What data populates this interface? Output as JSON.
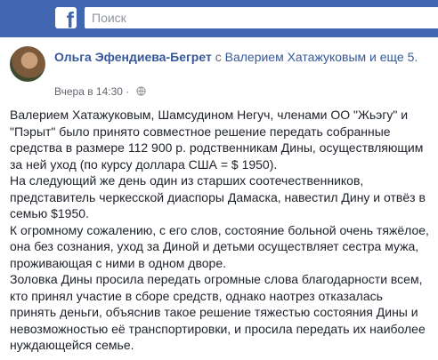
{
  "header": {
    "search_placeholder": "Поиск"
  },
  "post": {
    "author": "Ольга Эфендиева-Бегрет",
    "with_text": "с",
    "tagged": "Валерием Хатажуковым и еще 5.",
    "time": "Вчера в 14:30",
    "time_separator": "·",
    "paragraphs": [
      "Валерием Хатажуковым, Шамсудином Негуч, членами ОО \"Жьэгу\" и \"Пэрыт\" было принято совместное решение передать собранные средства в размере 112 900 р. родственникам Дины, осуществляющим за ней уход (по курсу доллара США = $ 1950).",
      "На следующий же день один из старших соотечественников, представитель черкесской диаспоры Дамаска, навестил Дину и отвёз в семью $1950.",
      "К огромному сожалению, с его слов, состояние больной очень тяжёлое, она без сознания, уход за Диной и детьми осуществляет сестра мужа, проживающая с ними в одном дворе.",
      "Золовка Дины просила передать огромные слова благодарности всем, кто принял участие в сборе средств, однако наотрез отказалась принять деньги, объяснив такое решение тяжестью состояния Дины и невозможностью её транспортировки, и просила передать их наиболее нуждающейся семье."
    ]
  },
  "colors": {
    "brand": "#4267b2",
    "link": "#365899",
    "text": "#1d2129",
    "muted": "#616770"
  },
  "icons": [
    "facebook-logo-icon",
    "avatar",
    "globe-icon"
  ]
}
